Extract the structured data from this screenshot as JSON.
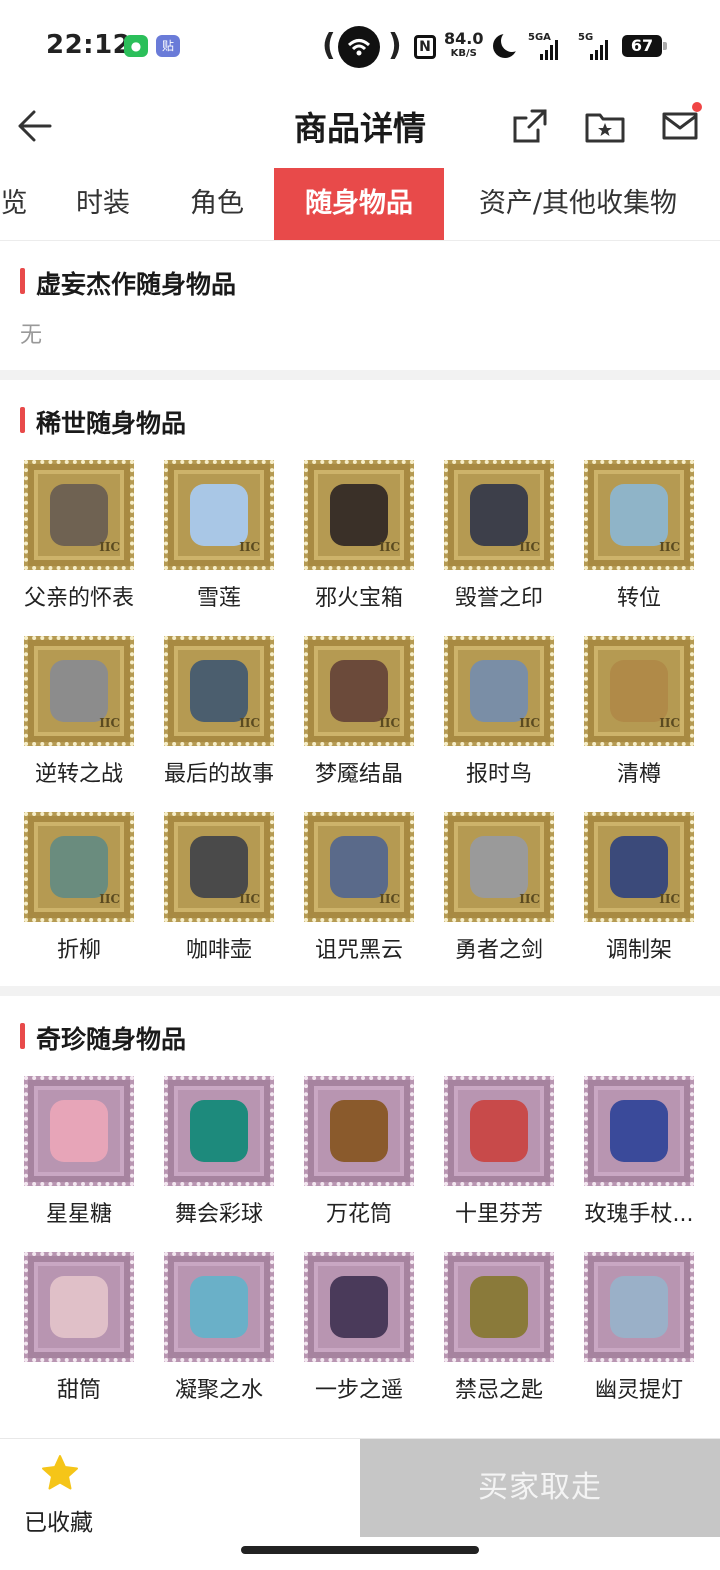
{
  "status_bar": {
    "time": "22:12",
    "wechat_icon": "wechat-icon",
    "tieba_glyph": "贴",
    "speed_value": "84.0",
    "speed_unit": "KB/S",
    "signal_1_label": "5GA",
    "signal_2_label": "5G",
    "battery": "67"
  },
  "header": {
    "title": "商品详情",
    "back_icon": "arrow-left-icon",
    "share_icon": "share-icon",
    "favorite_folder_icon": "folder-star-icon",
    "message_icon": "mail-icon"
  },
  "tabs": [
    {
      "label": "览",
      "active": false
    },
    {
      "label": "时装",
      "active": false
    },
    {
      "label": "角色",
      "active": false
    },
    {
      "label": "随身物品",
      "active": true
    },
    {
      "label": "资产/其他收集物",
      "active": false
    }
  ],
  "sections": {
    "legendary": {
      "title": "虚妄杰作随身物品",
      "empty_text": "无"
    },
    "rare": {
      "title": "稀世随身物品",
      "items": [
        {
          "name": "父亲的怀表"
        },
        {
          "name": "雪莲"
        },
        {
          "name": "邪火宝箱"
        },
        {
          "name": "毁誉之印"
        },
        {
          "name": "转位"
        },
        {
          "name": "逆转之战"
        },
        {
          "name": "最后的故事"
        },
        {
          "name": "梦魇结晶"
        },
        {
          "name": "报时鸟"
        },
        {
          "name": "清樽"
        },
        {
          "name": "折柳"
        },
        {
          "name": "咖啡壶"
        },
        {
          "name": "诅咒黑云"
        },
        {
          "name": "勇者之剑"
        },
        {
          "name": "调制架"
        }
      ]
    },
    "exotic": {
      "title": "奇珍随身物品",
      "items": [
        {
          "name": "星星糖"
        },
        {
          "name": "舞会彩球"
        },
        {
          "name": "万花筒"
        },
        {
          "name": "十里芬芳"
        },
        {
          "name": "玫瑰手杖..."
        },
        {
          "name": "甜筒"
        },
        {
          "name": "凝聚之水"
        },
        {
          "name": "一步之遥"
        },
        {
          "name": "禁忌之匙"
        },
        {
          "name": "幽灵提灯"
        }
      ]
    }
  },
  "stamp_mark": "IIC",
  "bottom_bar": {
    "favorite_label": "已收藏",
    "favorite_icon": "star-icon",
    "buy_label": "买家取走"
  },
  "colors": {
    "accent": "#e84a4a",
    "gold_frame": "#b59a52",
    "purple_frame": "#b895b1",
    "buy_disabled": "#c6c6c6",
    "star": "#f5c518"
  }
}
